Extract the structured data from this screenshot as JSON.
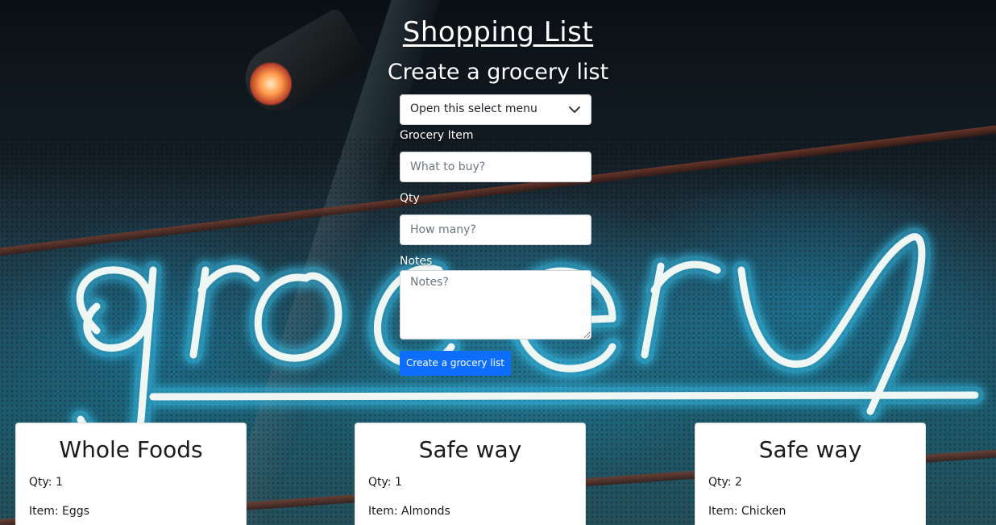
{
  "header": {
    "title": "Shopping List",
    "subtitle": "Create a grocery list"
  },
  "form": {
    "store_select": {
      "selected": "Open this select menu"
    },
    "item": {
      "label": "Grocery Item",
      "placeholder": "What to buy?"
    },
    "qty": {
      "label": "Qty",
      "placeholder": "How many?"
    },
    "notes": {
      "label": "Notes",
      "placeholder": "Notes?"
    },
    "submit_label": "Create a grocery list"
  },
  "background": {
    "sign_text": "grocery"
  },
  "cards": [
    {
      "store": "Whole Foods",
      "qty": "Qty: 1",
      "item": "Item: Eggs"
    },
    {
      "store": "Safe way",
      "qty": "Qty: 1",
      "item": "Item: Almonds"
    },
    {
      "store": "Safe way",
      "qty": "Qty: 2",
      "item": "Item: Chicken"
    }
  ],
  "colors": {
    "button": "#0d6efd",
    "neon": "#e8f6f4",
    "neon_glow": "#3ad0ff"
  },
  "icons": {
    "select_arrow": "chevron-down-icon"
  }
}
